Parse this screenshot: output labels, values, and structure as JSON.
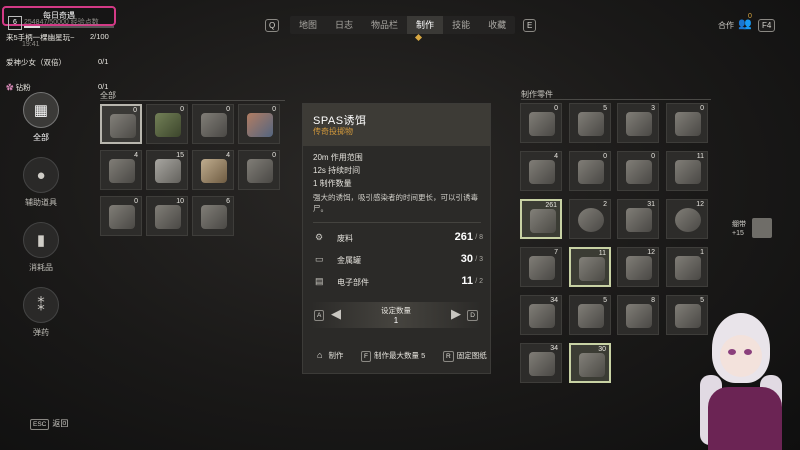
{
  "quests": {
    "daily_label": "每日奇遇",
    "items": [
      {
        "name": "来5手柄一棵幽星玩~",
        "progress": "2/100",
        "time": "19:41"
      },
      {
        "name": "爱神少女（双倍）",
        "progress": "0/1"
      },
      {
        "name": "钻粉",
        "progress": "0/1"
      }
    ]
  },
  "player": {
    "level": "6",
    "exp": "254847/50000 经验点数"
  },
  "nav": {
    "key_left": "Q",
    "key_right": "E",
    "tabs": [
      "地图",
      "日志",
      "物品栏",
      "制作",
      "技能",
      "收藏"
    ],
    "active": "制作"
  },
  "coop": {
    "label": "合作",
    "count": "0",
    "key": "F4"
  },
  "categories": [
    "全部",
    "辅助道具",
    "消耗品",
    "弹药"
  ],
  "inventory": {
    "section_label": "全部",
    "counts": [
      "0",
      "0",
      "0",
      "0",
      "4",
      "15",
      "4",
      "0",
      "0",
      "10",
      "6"
    ]
  },
  "detail": {
    "title": "SPAS诱饵",
    "subtitle": "传奇投掷物",
    "stats": [
      "20m 作用范围",
      "12s 持续时间",
      "1 制作数量"
    ],
    "description": "强大的诱饵，吸引感染者的时间更长，可以引诱毒尸。",
    "materials": [
      {
        "name": "废料",
        "have": "261",
        "need": "/ 8"
      },
      {
        "name": "金属罐",
        "have": "30",
        "need": "/ 3"
      },
      {
        "name": "电子部件",
        "have": "11",
        "need": "/ 2"
      }
    ],
    "quantity": {
      "label": "设定数量",
      "value": "1",
      "key_left": "A",
      "key_right": "D"
    },
    "actions": {
      "craft": "制作",
      "craft_max_key": "F",
      "craft_max": "制作最大数量 5",
      "pin_key": "R",
      "pin": "固定图纸"
    }
  },
  "parts": {
    "section_label": "制作零件",
    "counts": [
      "0",
      "5",
      "3",
      "0",
      "4",
      "0",
      "0",
      "11",
      "261",
      "2",
      "31",
      "12",
      "7",
      "11",
      "12",
      "1",
      "34",
      "5",
      "8",
      "5",
      "34",
      "30"
    ]
  },
  "pickup": {
    "name": "绷带",
    "amount": "+15"
  },
  "footer": {
    "esc_key": "ESC",
    "back": "返回"
  },
  "colors": {
    "accent": "#d49a3c",
    "highlight": "#c8d2a4",
    "daily_border": "#d33a86"
  }
}
